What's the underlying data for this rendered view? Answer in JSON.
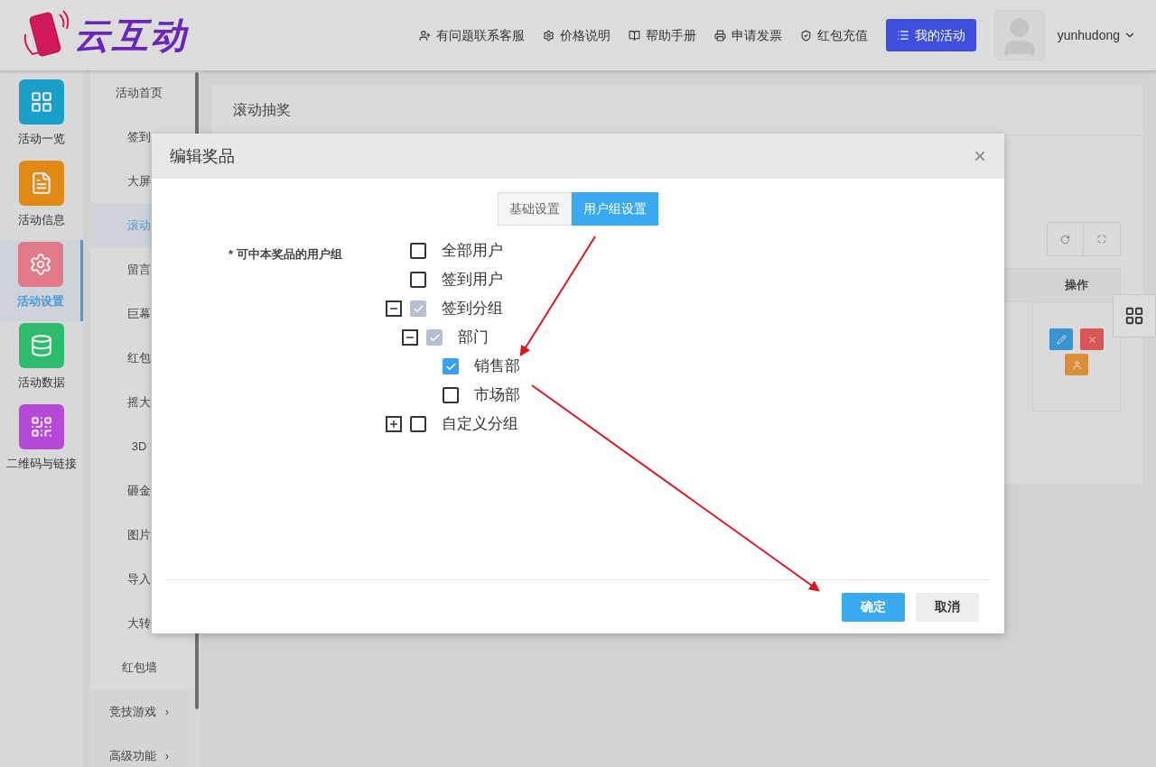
{
  "header": {
    "logo_text": "云互动",
    "links": [
      {
        "label": "有问题联系客服"
      },
      {
        "label": "价格说明"
      },
      {
        "label": "帮助手册"
      },
      {
        "label": "申请发票"
      },
      {
        "label": "红包充值"
      }
    ],
    "primary_button": "我的活动",
    "username": "yunhudong"
  },
  "nav": [
    {
      "label": "活动一览",
      "color": "#1aa0c8",
      "selected": false
    },
    {
      "label": "活动信息",
      "color": "#e08a14",
      "selected": false
    },
    {
      "label": "活动设置",
      "color": "#e07a88",
      "selected": true
    },
    {
      "label": "活动数据",
      "color": "#2dbb6e",
      "selected": false
    },
    {
      "label": "二维码与链接",
      "color": "#b649d8",
      "selected": false
    }
  ],
  "submenu": [
    {
      "label": "活动首页",
      "selected": false
    },
    {
      "label": "签到",
      "selected": false
    },
    {
      "label": "大屏",
      "selected": false
    },
    {
      "label": "滚动",
      "selected": true
    },
    {
      "label": "留言",
      "selected": false
    },
    {
      "label": "巨幕",
      "selected": false
    },
    {
      "label": "红包",
      "selected": false
    },
    {
      "label": "摇大",
      "selected": false
    },
    {
      "label": "3D",
      "selected": false
    },
    {
      "label": "砸金",
      "selected": false
    },
    {
      "label": "图片",
      "selected": false
    },
    {
      "label": "导入",
      "selected": false
    },
    {
      "label": "大转",
      "selected": false
    },
    {
      "label": "红包墙",
      "selected": false
    },
    {
      "label": "竞技游戏",
      "selected": false,
      "arrow": "›"
    },
    {
      "label": "高级功能",
      "selected": false,
      "arrow": "›"
    }
  ],
  "page_title": "滚动抽奖",
  "table": {
    "columns": [
      "操作"
    ]
  },
  "modal": {
    "title": "编辑奖品",
    "close": "×",
    "tabs": [
      {
        "label": "基础设置",
        "selected": false
      },
      {
        "label": "用户组设置",
        "selected": true
      }
    ],
    "field_label": "* 可中本奖品的用户组",
    "tree": [
      {
        "label": "全部用户",
        "checked": false,
        "indeterminate": false
      },
      {
        "label": "签到用户",
        "checked": false,
        "indeterminate": false
      },
      {
        "label": "签到分组",
        "checked": true,
        "indeterminate": true,
        "expanded": true,
        "children": [
          {
            "label": "部门",
            "checked": true,
            "indeterminate": true,
            "expanded": true,
            "children": [
              {
                "label": "销售部",
                "checked": true,
                "indeterminate": false
              },
              {
                "label": "市场部",
                "checked": false,
                "indeterminate": false
              }
            ]
          }
        ]
      },
      {
        "label": "自定义分组",
        "checked": false,
        "indeterminate": false,
        "expanded": false
      }
    ],
    "buttons": [
      {
        "label": "确定",
        "kind": "primary"
      },
      {
        "label": "取消",
        "kind": "secondary"
      }
    ]
  }
}
